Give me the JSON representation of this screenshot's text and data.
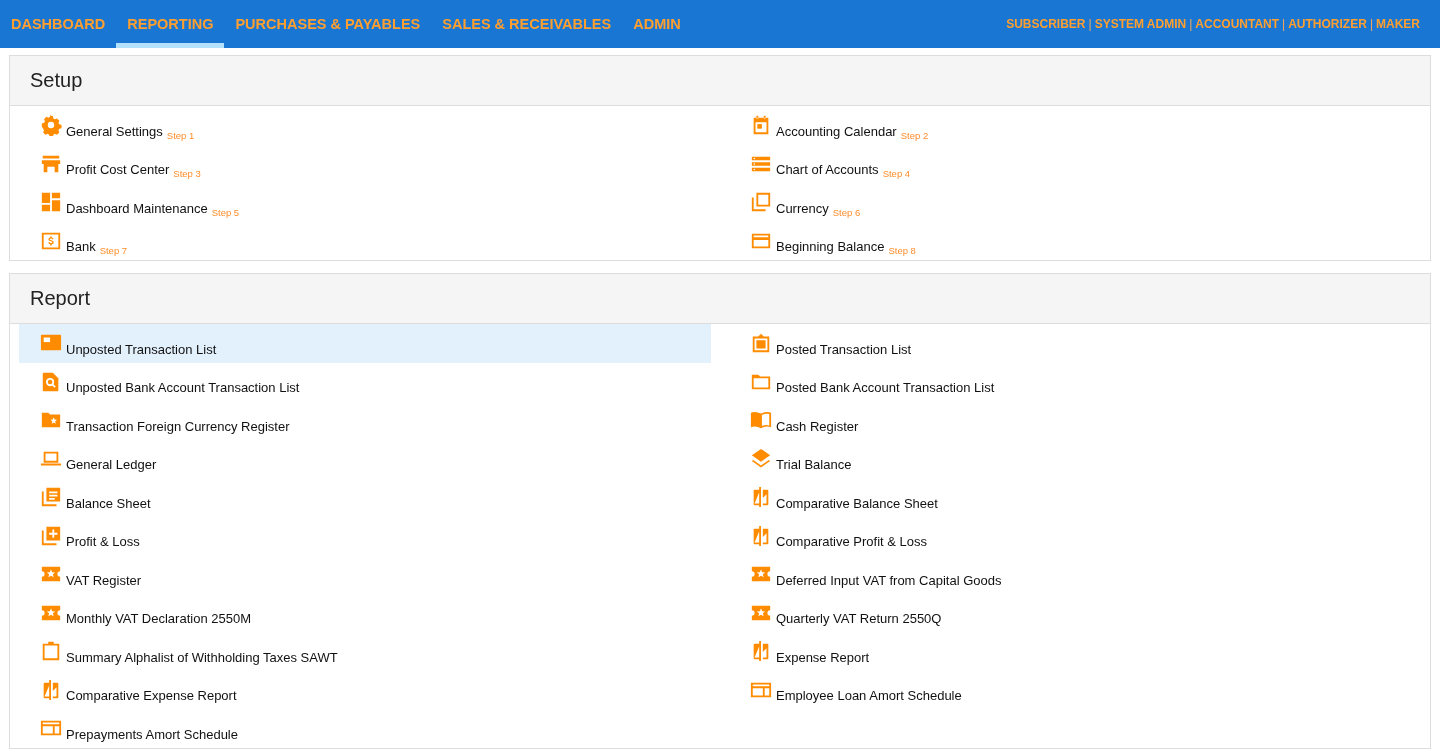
{
  "nav": {
    "tabs": [
      {
        "label": "DASHBOARD",
        "selected": false
      },
      {
        "label": "REPORTING",
        "selected": true
      },
      {
        "label": "PURCHASES & PAYABLES",
        "selected": false
      },
      {
        "label": "SALES & RECEIVABLES",
        "selected": false
      },
      {
        "label": "ADMIN",
        "selected": false
      }
    ],
    "roles": [
      {
        "kind": "link",
        "text": "SUBSCRIBER"
      },
      {
        "kind": "separator",
        "text": "|"
      },
      {
        "kind": "link",
        "text": "SYSTEM ADMIN"
      },
      {
        "kind": "separator",
        "text": "|"
      },
      {
        "kind": "link",
        "text": "ACCOUNTANT"
      },
      {
        "kind": "separator",
        "text": "|"
      },
      {
        "kind": "link",
        "text": "AUTHORIZER"
      },
      {
        "kind": "separator",
        "text": "|"
      },
      {
        "kind": "link",
        "text": "MAKER"
      }
    ]
  },
  "sections": [
    {
      "title": "Setup",
      "items": [
        {
          "label": "General Settings",
          "step": "Step 1",
          "selected": false
        },
        {
          "label": "Accounting Calendar",
          "step": "Step 2",
          "selected": false
        },
        {
          "label": "Profit Cost Center",
          "step": "Step 3",
          "selected": false
        },
        {
          "label": "Chart of Accounts",
          "step": "Step 4",
          "selected": false
        },
        {
          "label": "Dashboard Maintenance",
          "step": "Step 5",
          "selected": false
        },
        {
          "label": "Currency",
          "step": "Step 6",
          "selected": false
        },
        {
          "label": "Bank",
          "step": "Step 7",
          "selected": false
        },
        {
          "label": "Beginning Balance",
          "step": "Step 8",
          "selected": false
        }
      ]
    },
    {
      "title": "Report",
      "items": [
        {
          "label": "Unposted Transaction List",
          "selected": true
        },
        {
          "label": "Posted Transaction List",
          "selected": false
        },
        {
          "label": "Unposted Bank Account Transaction List",
          "selected": false
        },
        {
          "label": "Posted Bank Account Transaction List",
          "selected": false
        },
        {
          "label": "Transaction Foreign Currency Register",
          "selected": false
        },
        {
          "label": "Cash Register",
          "selected": false
        },
        {
          "label": "General Ledger",
          "selected": false
        },
        {
          "label": "Trial Balance",
          "selected": false
        },
        {
          "label": "Balance Sheet",
          "selected": false
        },
        {
          "label": "Comparative Balance Sheet",
          "selected": false
        },
        {
          "label": "Profit & Loss",
          "selected": false
        },
        {
          "label": "Comparative Profit & Loss",
          "selected": false
        },
        {
          "label": "VAT Register",
          "selected": false
        },
        {
          "label": "Deferred Input VAT from Capital Goods",
          "selected": false
        },
        {
          "label": "Monthly VAT Declaration 2550M",
          "selected": false
        },
        {
          "label": "Quarterly VAT Return 2550Q",
          "selected": false
        },
        {
          "label": "Summary Alphalist of Withholding Taxes SAWT",
          "selected": false
        },
        {
          "label": "Expense Report",
          "selected": false
        },
        {
          "label": "Comparative Expense Report",
          "selected": false
        },
        {
          "label": "Employee Loan Amort Schedule",
          "selected": false
        },
        {
          "label": "Prepayments Amort Schedule",
          "selected": false
        }
      ]
    }
  ]
}
